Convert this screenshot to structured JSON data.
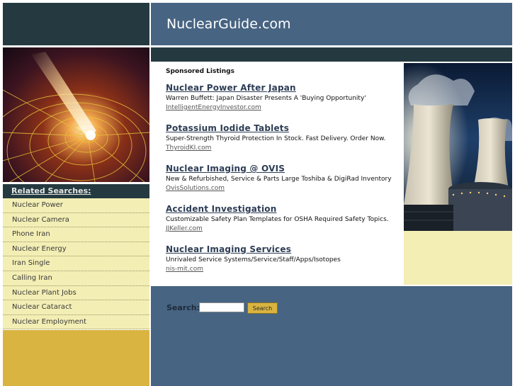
{
  "site": {
    "title": "NuclearGuide.com"
  },
  "sidebar": {
    "heading": "Related Searches:",
    "items": [
      "Nuclear Power",
      "Nuclear Camera",
      "Phone Iran",
      "Nuclear Energy",
      "Iran Single",
      "Calling Iran",
      "Nuclear Plant Jobs",
      "Nuclear Cataract",
      "Nuclear Employment"
    ]
  },
  "sponsored": {
    "heading": "Sponsored Listings",
    "listings": [
      {
        "title": "Nuclear Power After Japan",
        "desc": "Warren Buffett: Japan Disaster Presents A 'Buying Opportunity'",
        "url": "IntelligentEnergyInvestor.com"
      },
      {
        "title": "Potassium Iodide Tablets",
        "desc": "Super-Strength Thyroid Protection In Stock. Fast Delivery. Order Now.",
        "url": "ThyroidKI.com"
      },
      {
        "title": "Nuclear Imaging @ OVIS",
        "desc": "New & Refurbished, Service & Parts Large Toshiba & DigiRad Inventory",
        "url": "OvisSolutions.com"
      },
      {
        "title": "Accident Investigation",
        "desc": "Customizable Safety Plan Templates for OSHA Required Safety Topics.",
        "url": "JJKeller.com"
      },
      {
        "title": "Nuclear Imaging Services",
        "desc": "Unrivaled Service Systems/Service/Staff/Apps/Isotopes",
        "url": "nis-mit.com"
      }
    ]
  },
  "search": {
    "label": "Search:",
    "input_value": "",
    "button_label": "Search"
  },
  "colors": {
    "header_blue": "#476482",
    "dark_bar": "#243a40",
    "sidebar_cream": "#f3eeb4",
    "gold": "#d9b441"
  }
}
